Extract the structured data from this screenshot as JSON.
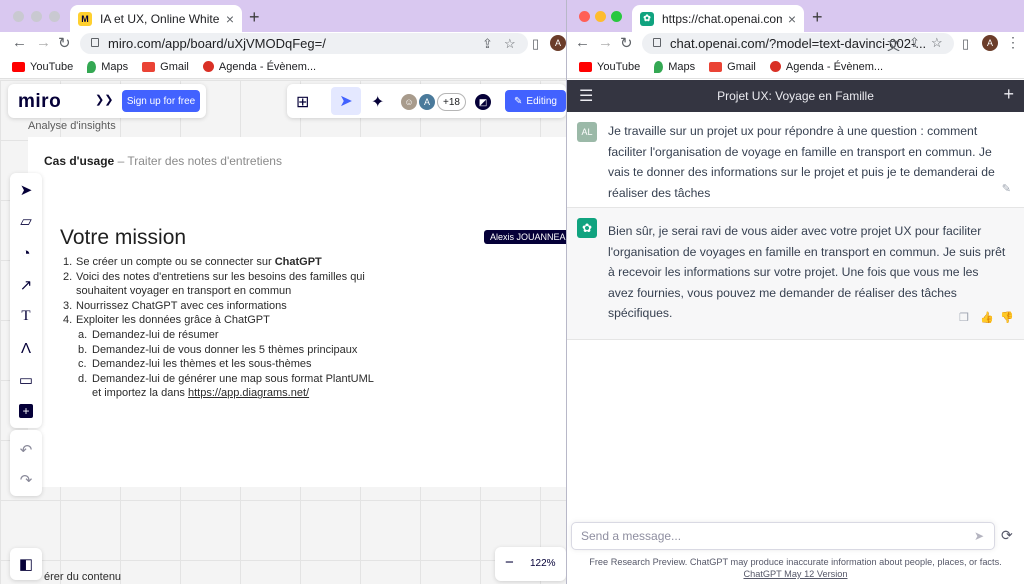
{
  "left_window": {
    "tab_title": "IA et UX, Online Whiteboard fo",
    "url": "miro.com/app/board/uXjVMODqFeg=/",
    "profile_initial": "A",
    "bookmarks": [
      "YouTube",
      "Maps",
      "Gmail",
      "Agenda - Évènem..."
    ]
  },
  "miro": {
    "logo": "miro",
    "signup_label": "Sign up for free",
    "collaborator_count": "+18",
    "avatar_initial": "A",
    "editing_label": "Editing",
    "frame_label": "Analyse d'insights",
    "use_case_title": "Cas d'usage",
    "use_case_subtitle": "– Traiter des notes d'entretiens",
    "mission_title": "Votre mission",
    "user_tag": "Alexis JOUANNEA",
    "steps": [
      {
        "num": "1.",
        "text_before": "Se créer un compte ou se connecter sur ",
        "bold": "ChatGPT"
      },
      {
        "num": "2.",
        "text": "Voici des notes d'entretiens sur les besoins des familles qui souhaitent voyager en transport en commun"
      },
      {
        "num": "3.",
        "text": "Nourrissez ChatGPT avec ces informations"
      },
      {
        "num": "4.",
        "text": "Exploiter les données grâce à ChatGPT"
      }
    ],
    "substeps": [
      {
        "num": "a.",
        "text": "Demandez-lui de résumer"
      },
      {
        "num": "b.",
        "text": "Demandez-lui de vous donner les 5 thèmes principaux"
      },
      {
        "num": "c.",
        "text": "Demandez-lui les thèmes et les sous-thèmes"
      },
      {
        "num": "d.",
        "text": "Demandez-lui de générer une map sous format PlantUML et importez la dans ",
        "link": "https://app.diagrams.net/"
      }
    ],
    "bottom_text": "érer du contenu",
    "zoom": "122%"
  },
  "right_window": {
    "tab_title": "https://chat.openai.com/?mode",
    "url": "chat.openai.com/?model=text-davinci-002-...",
    "profile_initial": "A",
    "bookmarks": [
      "YouTube",
      "Maps",
      "Gmail",
      "Agenda - Évènem..."
    ]
  },
  "chat": {
    "title": "Projet UX: Voyage en Famille",
    "user_avatar": "AL",
    "user_message": "Je travaille sur un projet ux pour répondre à une question : comment faciliter l'organisation de voyage en famille en transport en commun. Je vais te donner des informations sur le projet et puis je te demanderai de réaliser des tâches",
    "bot_message": "Bien sûr, je serai ravi de vous aider avec votre projet UX pour faciliter l'organisation de voyages en famille en transport en commun. Je suis prêt à recevoir les informations sur votre projet. Une fois que vous me les avez fournies, vous pouvez me demander de réaliser des tâches spécifiques.",
    "input_placeholder": "Send a message...",
    "footer_text": "Free Research Preview. ChatGPT may produce inaccurate information about people, places, or facts. ",
    "footer_link": "ChatGPT May 12 Version"
  },
  "colors": {
    "tab_bar": "#d9c8f0",
    "miro_blue": "#4262ff",
    "miro_navy": "#050038",
    "chat_header": "#343541",
    "user_avatar": "#9bb9a8",
    "gpt_green": "#10a37f"
  }
}
